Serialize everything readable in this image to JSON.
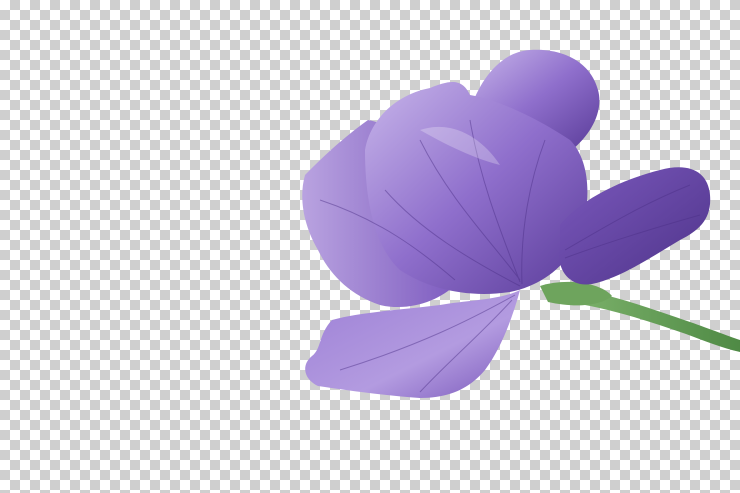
{
  "image": {
    "subject": "purple-iris-flower",
    "background": "transparency-checkerboard",
    "colors": {
      "checker_light": "#ffffff",
      "checker_dark": "#cfcfcf",
      "petal_light": "#b9a3e0",
      "petal_mid": "#8d6cc9",
      "petal_dark": "#5a3c99",
      "petal_vein": "#4b2f86",
      "stem": "#5f9a52",
      "stem_dark": "#3f7236"
    }
  }
}
